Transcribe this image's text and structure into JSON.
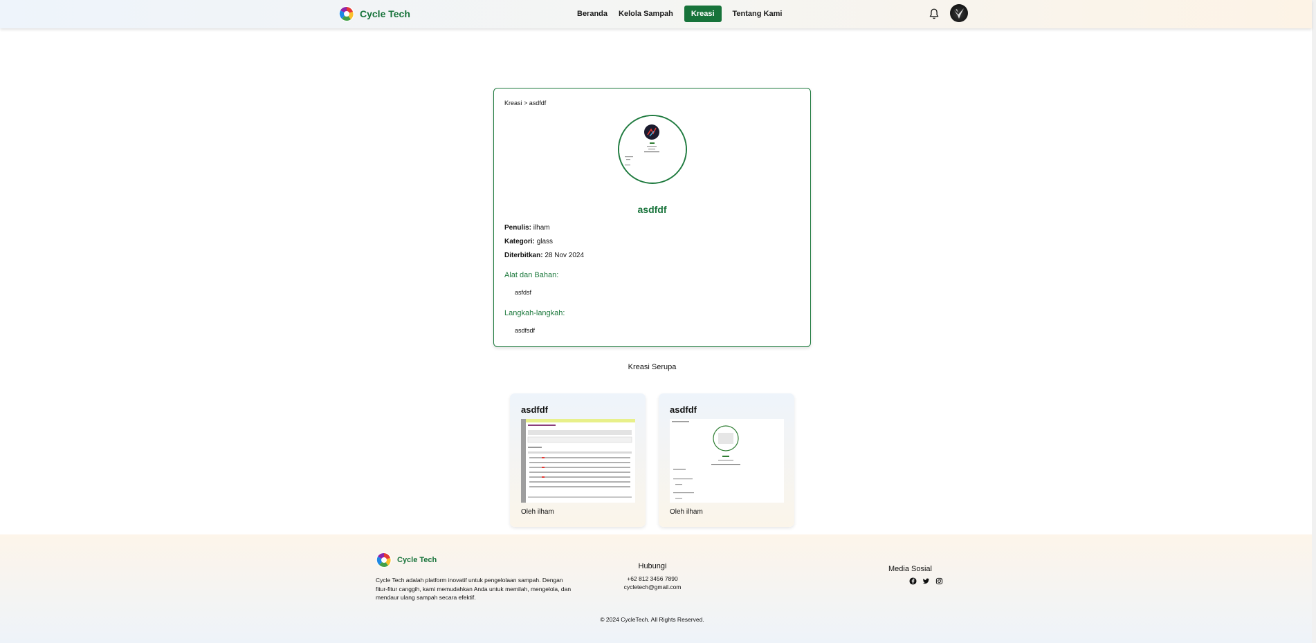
{
  "brand": {
    "name": "Cycle Tech"
  },
  "nav": {
    "items": [
      {
        "label": "Beranda"
      },
      {
        "label": "Kelola Sampah"
      },
      {
        "label": "Kreasi"
      },
      {
        "label": "Tentang Kami"
      }
    ],
    "active": "Kreasi"
  },
  "icons": {
    "notification": "bell-icon",
    "profile": "avatar"
  },
  "post": {
    "breadcrumb": "Kreasi > asdfdf",
    "title": "asdfdf",
    "author_label": "Penulis:",
    "author": "ilham",
    "category_label": "Kategori:",
    "category": "glass",
    "published_label": "Diterbitkan:",
    "published": "28 Nov 2024",
    "materials_heading": "Alat dan Bahan:",
    "materials": "asfdsf",
    "steps_heading": "Langkah-langkah:",
    "steps": "asdfsdf"
  },
  "similar": {
    "heading": "Kreasi Serupa",
    "items": [
      {
        "title": "asdfdf",
        "author": "Oleh ilham"
      },
      {
        "title": "asdfdf",
        "author": "Oleh ilham"
      }
    ]
  },
  "footer": {
    "brand": "Cycle Tech",
    "description": "Cycle Tech adalah platform inovatif untuk pengelolaan sampah. Dengan fitur-fitur canggih, kami memudahkan Anda untuk memilah, mengelola, dan mendaur ulang sampah secara efektif.",
    "contact_heading": "Hubungi",
    "phone": "+62 812 3456 7890",
    "email": "cycletech@gmail.com",
    "social_heading": "Media Sosial",
    "social_icons": [
      "facebook-icon",
      "twitter-icon",
      "instagram-icon"
    ],
    "copyright": "© 2024 CycleTech. All Rights Reserved."
  },
  "colors": {
    "primary": "#17733a",
    "border": "#1e7a3e"
  }
}
